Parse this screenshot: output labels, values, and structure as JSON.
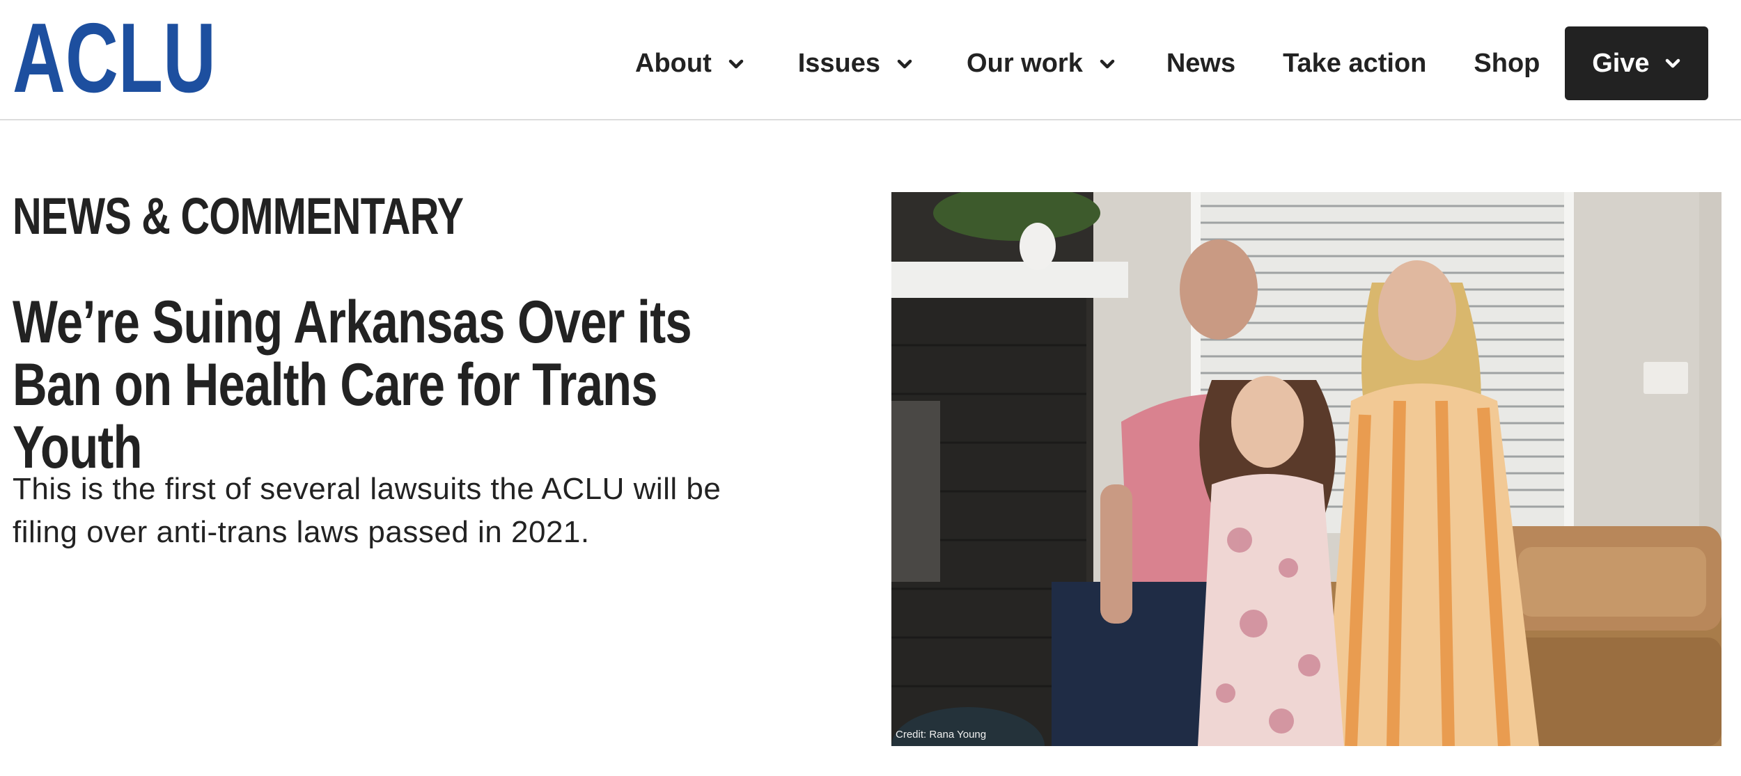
{
  "brand": {
    "logo_text": "ACLU",
    "logo_color": "#1d4f9f"
  },
  "nav": {
    "items": [
      {
        "label": "About",
        "has_dropdown": true
      },
      {
        "label": "Issues",
        "has_dropdown": true
      },
      {
        "label": "Our work",
        "has_dropdown": true
      },
      {
        "label": "News",
        "has_dropdown": false
      },
      {
        "label": "Take action",
        "has_dropdown": false
      },
      {
        "label": "Shop",
        "has_dropdown": false
      }
    ],
    "give": {
      "label": "Give",
      "has_dropdown": true,
      "background": "#222222"
    },
    "chevron_icon": "chevron-down-icon"
  },
  "hero": {
    "section_label": "NEWS & COMMENTARY",
    "headline": "We’re Suing Arkansas Over its Ban on Health Care for Trans Youth",
    "dek": "This is the first of several lawsuits the ACLU will be filing over anti-trans laws passed in 2021.",
    "image": {
      "credit": "Credit: Rana Young"
    }
  },
  "colors": {
    "text": "#222222",
    "background": "#ffffff",
    "divider": "#dcdcdc"
  }
}
